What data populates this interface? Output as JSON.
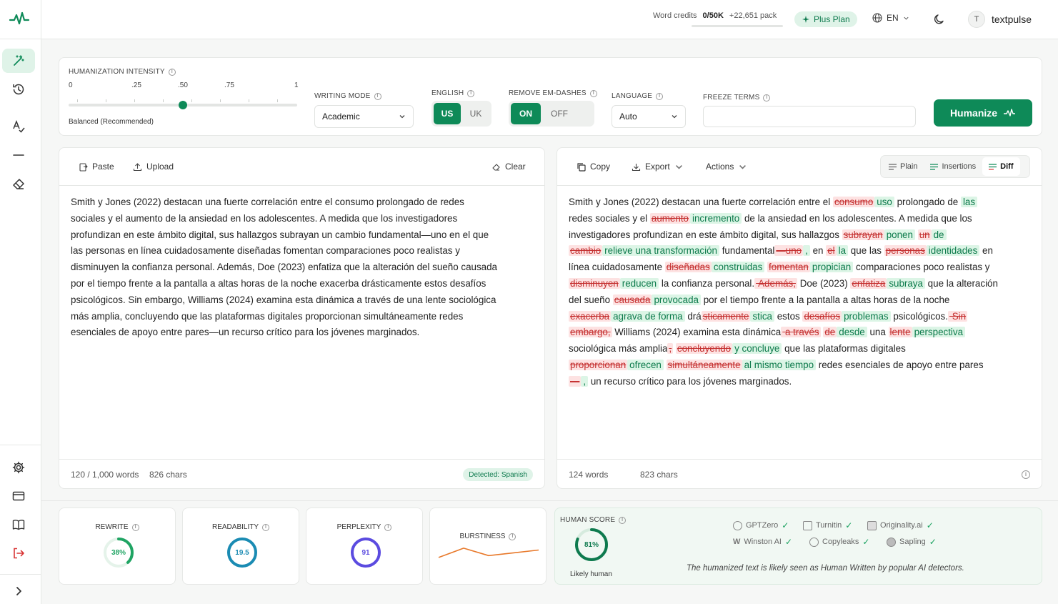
{
  "topbar": {
    "credits_label": "Word credits",
    "credits_value": "0/50K",
    "credits_pack": "+22,651 pack",
    "plan": "Plus Plan",
    "language": "EN",
    "user_initial": "T",
    "username": "textpulse"
  },
  "controls": {
    "intensity_label": "HUMANIZATION INTENSITY",
    "ticks": [
      "0",
      ".25",
      ".50",
      ".75",
      "1"
    ],
    "intensity_value": 0.5,
    "intensity_caption": "Balanced (Recommended)",
    "writing_mode_label": "WRITING MODE",
    "writing_mode": "Academic",
    "english_label": "ENGLISH",
    "english_us": "US",
    "english_uk": "UK",
    "em_dash_label": "REMOVE EM-DASHES",
    "em_on": "ON",
    "em_off": "OFF",
    "language_label": "LANGUAGE",
    "language": "Auto",
    "freeze_label": "FREEZE TERMS",
    "freeze_value": "",
    "humanize": "Humanize"
  },
  "input": {
    "paste": "Paste",
    "upload": "Upload",
    "clear": "Clear",
    "lines": [
      "Smith y Jones (2022) destacan una fuerte correlación entre el consumo prolongado de redes",
      "sociales y el aumento de la ansiedad en los adolescentes. A medida que los investigadores",
      "profundizan en este ámbito digital, sus hallazgos subrayan un cambio fundamental—uno en el que",
      "las personas en línea cuidadosamente diseñadas fomentan comparaciones poco realistas y",
      "disminuyen la confianza personal. Además, Doe (2023) enfatiza que la alteración del sueño causada",
      "por el tiempo frente a la pantalla a altas horas de la noche exacerba drásticamente estos desafíos",
      "psicológicos. Sin embargo, Williams (2024) examina esta dinámica a través de una lente sociológica",
      "más amplia, concluyendo que las plataformas digitales proporcionan simultáneamente redes",
      "esenciales de apoyo entre pares—un recurso crítico para los jóvenes marginados."
    ],
    "word_count": "120 / 1,000 words",
    "char_count": "826 chars",
    "detected": "Detected: Spanish"
  },
  "output": {
    "copy": "Copy",
    "export": "Export",
    "actions": "Actions",
    "view_plain": "Plain",
    "view_insertions": "Insertions",
    "view_diff": "Diff",
    "lines": [
      [
        [
          "t",
          "Smith y Jones (2022) destacan una fuerte correlación entre el "
        ],
        [
          "d",
          "consumo"
        ],
        [
          "i",
          "uso"
        ],
        [
          "t",
          " prolongado de "
        ],
        [
          "i",
          "las"
        ]
      ],
      [
        [
          "t",
          "redes sociales y el "
        ],
        [
          "d",
          "aumento"
        ],
        [
          "i",
          "incremento"
        ],
        [
          "t",
          " de la ansiedad en los adolescentes. A medida que los"
        ]
      ],
      [
        [
          "t",
          "investigadores profundizan en este ámbito digital, sus hallazgos "
        ],
        [
          "d",
          "subrayan"
        ],
        [
          "i",
          "ponen"
        ],
        [
          "t",
          " "
        ],
        [
          "d",
          "un"
        ],
        [
          "i",
          "de"
        ]
      ],
      [
        [
          "d",
          "cambio"
        ],
        [
          "i",
          "relieve una transformación"
        ],
        [
          "t",
          " fundamental"
        ],
        [
          "d",
          "—uno"
        ],
        [
          "i",
          ","
        ],
        [
          "t",
          " en "
        ],
        [
          "d",
          "el"
        ],
        [
          "i",
          "la"
        ],
        [
          "t",
          " que las "
        ],
        [
          "d",
          "personas"
        ],
        [
          "i",
          "identidades"
        ],
        [
          "t",
          " en"
        ]
      ],
      [
        [
          "t",
          "línea cuidadosamente "
        ],
        [
          "d",
          "diseñadas"
        ],
        [
          "i",
          "construidas"
        ],
        [
          "t",
          " "
        ],
        [
          "d",
          "fomentan"
        ],
        [
          "i",
          "propician"
        ],
        [
          "t",
          " comparaciones poco realistas y"
        ]
      ],
      [
        [
          "d",
          "disminuyen"
        ],
        [
          "i",
          "reducen"
        ],
        [
          "t",
          " la confianza personal."
        ],
        [
          "d",
          " Además,"
        ],
        [
          "t",
          " Doe (2023) "
        ],
        [
          "d",
          "enfatiza"
        ],
        [
          "i",
          "subraya"
        ],
        [
          "t",
          " que la alteración"
        ]
      ],
      [
        [
          "t",
          "del sueño "
        ],
        [
          "d",
          "causada"
        ],
        [
          "i",
          "provocada"
        ],
        [
          "t",
          " por el tiempo frente a la pantalla a altas horas de la noche"
        ]
      ],
      [
        [
          "d",
          "exacerba"
        ],
        [
          "i",
          "agrava de forma"
        ],
        [
          "t",
          " drá"
        ],
        [
          "d",
          "sticamente"
        ],
        [
          "i",
          "stica"
        ],
        [
          "t",
          " estos "
        ],
        [
          "d",
          "desafíos"
        ],
        [
          "i",
          "problemas"
        ],
        [
          "t",
          " psicológicos."
        ],
        [
          "d",
          " Sin"
        ]
      ],
      [
        [
          "d",
          "embargo,"
        ],
        [
          "t",
          " Williams (2024) examina esta dinámica"
        ],
        [
          "d",
          " a través"
        ],
        [
          "t",
          " "
        ],
        [
          "d",
          "de"
        ],
        [
          "i",
          "desde"
        ],
        [
          "t",
          " una "
        ],
        [
          "d",
          "lente"
        ],
        [
          "i",
          "perspectiva"
        ]
      ],
      [
        [
          "t",
          "sociológica más amplia"
        ],
        [
          "d",
          ","
        ],
        [
          "t",
          " "
        ],
        [
          "d",
          "concluyendo"
        ],
        [
          "i",
          "y concluye"
        ],
        [
          "t",
          " que las plataformas digitales"
        ]
      ],
      [
        [
          "d",
          "proporcionan"
        ],
        [
          "i",
          "ofrecen"
        ],
        [
          "t",
          " "
        ],
        [
          "d",
          "simultáneamente"
        ],
        [
          "i",
          "al mismo tiempo"
        ],
        [
          "t",
          " redes esenciales de apoyo entre pares"
        ]
      ],
      [
        [
          "d",
          "—"
        ],
        [
          "i",
          ","
        ],
        [
          "t",
          " un recurso crítico para los jóvenes marginados."
        ]
      ]
    ],
    "word_count": "124 words",
    "char_count": "823 chars"
  },
  "metrics": {
    "rewrite_label": "REWRITE",
    "rewrite_value": "38%",
    "rewrite_fraction": 0.38,
    "readability_label": "READABILITY",
    "readability_value": "19.5",
    "readability_fraction": 1.0,
    "perplexity_label": "PERPLEXITY",
    "perplexity_value": "91",
    "perplexity_fraction": 1.0,
    "burstiness_label": "BURSTINESS",
    "burstiness_series": [
      0.35,
      0.85,
      0.45,
      0.6,
      0.75
    ],
    "human_label": "HUMAN SCORE",
    "human_value": "81%",
    "human_fraction": 0.81,
    "human_caption": "Likely human",
    "detectors": [
      "GPTZero",
      "Turnitin",
      "Originality.ai",
      "Winston AI",
      "Copyleaks",
      "Sapling"
    ],
    "human_note": "The humanized text is likely seen as Human Written by popular AI detectors."
  },
  "colors": {
    "brand": "#0e8a58",
    "rewrite": "#1fa463",
    "readability": "#1a8bb3",
    "perplexity": "#5b4be0",
    "burstiness": "#e8792b",
    "human": "#0e7a4e"
  }
}
